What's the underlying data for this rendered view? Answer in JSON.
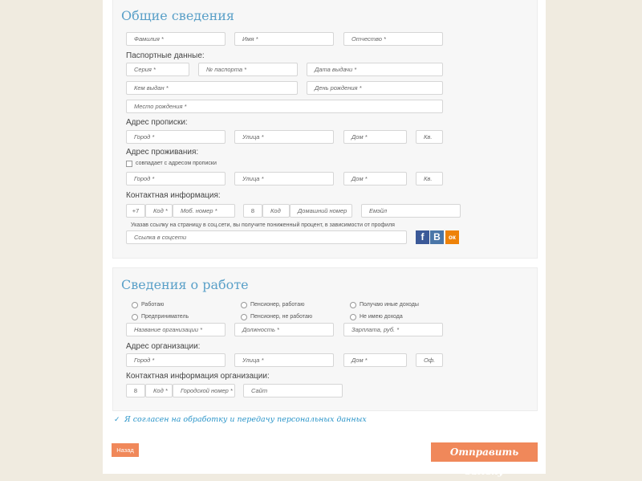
{
  "general": {
    "title": "Общие сведения",
    "last_name": "Фамилия *",
    "first_name": "Имя *",
    "patronymic": "Отчество *",
    "passport_label": "Паспортные данные:",
    "series": "Серия *",
    "passport_no": "№ паспорта *",
    "issue_date": "Дата выдачи *",
    "issued_by": "Кем выдан *",
    "birth_date": "День рождения *",
    "birth_place": "Место рождения *",
    "reg_label": "Адрес прописки:",
    "reg_city": "Город *",
    "reg_street": "Улица *",
    "reg_house": "Дом *",
    "reg_apt": "Кв.",
    "live_label": "Адрес проживания:",
    "same_label": "совпадает с адресом прописки",
    "live_city": "Город *",
    "live_street": "Улица *",
    "live_house": "Дом *",
    "live_apt": "Кв.",
    "contact_label": "Контактная информация:",
    "mob_prefix": "+7",
    "mob_code": "Код *",
    "mob_number": "Моб. номер *",
    "home_prefix": "8",
    "home_code": "Код",
    "home_number": "Домашний номер",
    "email": "Емэйл",
    "social_hint": "Указав ссылку на страницу в соц.сети, вы получите пониженный процент, в зависимости от профиля",
    "social_link": "Ссылка в соцсети",
    "social_fb": "f",
    "social_vk": "B",
    "social_ok": "ок"
  },
  "work": {
    "title": "Сведения о работе",
    "opt_employed": "Работаю",
    "opt_pensioner_working": "Пенсионер, работаю",
    "opt_other_income": "Получаю иные доходы",
    "opt_entrepreneur": "Предприниматель",
    "opt_pensioner_not_working": "Пенсионер, не работаю",
    "opt_no_income": "Не имею дохода",
    "org_name": "Название организации *",
    "position": "Должность *",
    "salary": "Зарплата, руб. *",
    "org_addr_label": "Адрес организации:",
    "org_city": "Город *",
    "org_street": "Улица *",
    "org_house": "Дом *",
    "org_office": "Оф.",
    "org_contact_label": "Контактная информация организации:",
    "org_prefix": "8",
    "org_code": "Код *",
    "org_phone": "Городской номер *",
    "org_site": "Сайт"
  },
  "agree_label": "Я согласен на обработку и передачу персональных данных",
  "back_label": "Назад",
  "submit_label": "Отправить заявку",
  "colors": {
    "accent_orange": "#f0885a",
    "title_blue": "#5aa0c8",
    "link_blue": "#2b95c9",
    "fb": "#3b5998",
    "vk": "#4a76a8",
    "ok": "#ee8208"
  }
}
